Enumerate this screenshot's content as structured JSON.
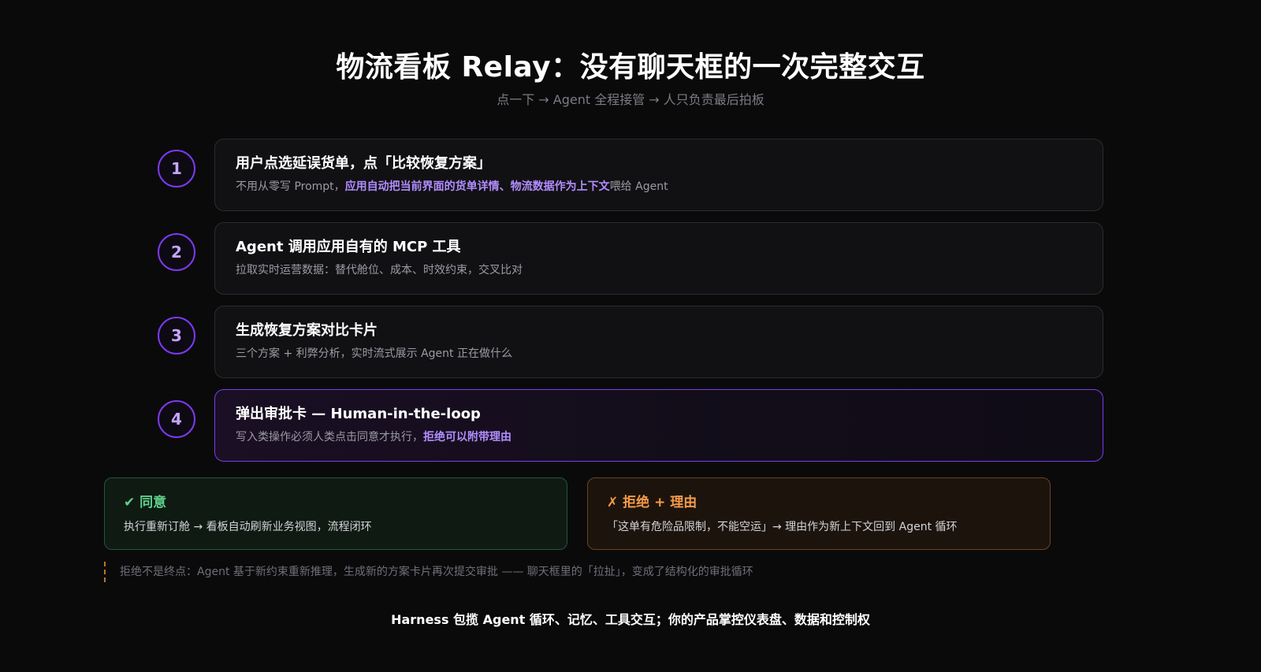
{
  "title": "物流看板 Relay：没有聊天框的一次完整交互",
  "subtitle": "点一下 → Agent 全程接管 → 人只负责最后拍板",
  "steps": [
    {
      "number": "1",
      "title": "用户点选延误货单，点「比较恢复方案」",
      "desc_before": "不用从零写 Prompt，",
      "desc_highlight": "应用自动把当前界面的货单详情、物流数据作为上下文",
      "desc_after": "喂给 Agent"
    },
    {
      "number": "2",
      "title": "Agent 调用应用自有的 MCP 工具",
      "desc": "拉取实时运营数据：替代舱位、成本、时效约束，交叉比对"
    },
    {
      "number": "3",
      "title": "生成恢复方案对比卡片",
      "desc": "三个方案 + 利弊分析，实时流式展示 Agent 正在做什么"
    },
    {
      "number": "4",
      "title": "弹出审批卡 — Human-in-the-loop",
      "desc_before": "写入类操作必须人类点击同意才执行，",
      "desc_highlight": "拒绝可以附带理由"
    }
  ],
  "outcomes": {
    "agree": {
      "title": "✔ 同意",
      "desc": "执行重新订舱 → 看板自动刷新业务视图，流程闭环"
    },
    "reject": {
      "title": "✗ 拒绝 + 理由",
      "desc": "「这单有危险品限制，不能空运」→ 理由作为新上下文回到 Agent 循环"
    }
  },
  "note": "拒绝不是终点：Agent 基于新约束重新推理，生成新的方案卡片再次提交审批 —— 聊天框里的「拉扯」，变成了结构化的审批循环",
  "footer": "Harness 包揽 Agent 循环、记忆、工具交互；你的产品掌控仪表盘、数据和控制权",
  "colors": {
    "accent_purple": "#7c3aed",
    "highlight_text": "#b28dff",
    "agree_green": "#5fd08a",
    "reject_orange": "#f59a4a"
  }
}
